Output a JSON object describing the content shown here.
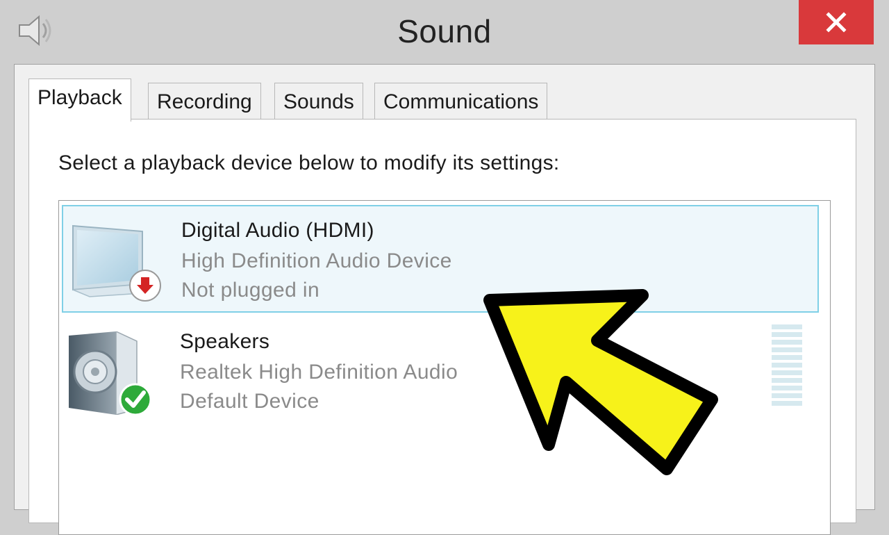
{
  "window": {
    "title": "Sound",
    "close_label": "×",
    "icon": "speaker-app-icon",
    "accent_close": "#d9393b"
  },
  "tabs": [
    {
      "label": "Playback",
      "active": true
    },
    {
      "label": "Recording",
      "active": false
    },
    {
      "label": "Sounds",
      "active": false
    },
    {
      "label": "Communications",
      "active": false
    }
  ],
  "playback": {
    "instruction": "Select a playback device below to modify its settings:",
    "devices": [
      {
        "name": "Digital Audio (HDMI)",
        "description": "High Definition Audio Device",
        "status": "Not plugged in",
        "icon": "monitor-icon",
        "badge": "unplugged-arrow-icon",
        "selected": true
      },
      {
        "name": "Speakers",
        "description": "Realtek High Definition Audio",
        "status": "Default Device",
        "icon": "speaker-icon",
        "badge": "default-check-icon",
        "selected": false
      }
    ]
  },
  "overlay": {
    "arrow_color": "#f7f21a",
    "icon": "yellow-arrow-icon"
  }
}
